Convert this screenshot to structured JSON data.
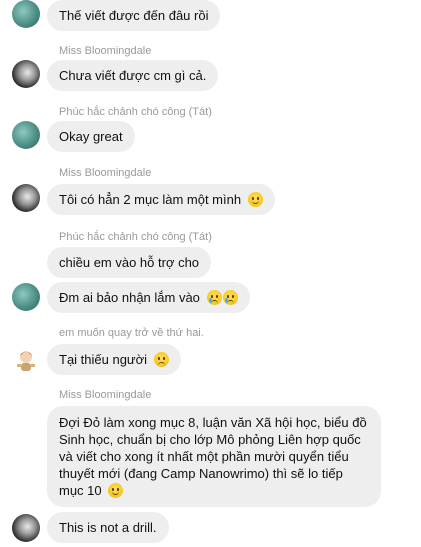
{
  "messages": [
    {
      "sender": "",
      "text": "Thế viết được đến đâu rồi",
      "emoji": []
    },
    {
      "sender": "Miss Bloomingdale",
      "text": "Chưa viết được cm gì cả.",
      "emoji": []
    },
    {
      "sender": "Phúc hắc chảnh chó công (Tát)",
      "text": "Okay great",
      "emoji": []
    },
    {
      "sender": "Miss Bloomingdale",
      "text": "Tôi có hẳn 2 mục làm một mình",
      "emoji": [
        "smile"
      ]
    },
    {
      "sender": "Phúc hắc chảnh chó công (Tát)",
      "text": "chiều em vào hỗ trợ cho",
      "emoji": []
    },
    {
      "sender": "",
      "text": "Đm ai bảo nhận lắm vào",
      "emoji": [
        "cry",
        "cry"
      ]
    },
    {
      "sender": "em muốn quay trở về thứ hai.",
      "text": "Tại thiếu người",
      "emoji": [
        "sad"
      ]
    },
    {
      "sender": "Miss Bloomingdale",
      "text": "Đợi Đỏ làm xong mục 8, luận văn Xã hội học, biểu đồ Sinh học, chuẩn bị cho lớp Mô phỏng Liên hợp quốc và viết cho xong ít nhất một phần mười quyển tiểu thuyết mới (đang Camp Nanowrimo) thì sẽ lo tiếp mục 10",
      "emoji": [
        "smile"
      ]
    },
    {
      "sender": "",
      "text": "This is not a drill.",
      "emoji": []
    }
  ],
  "colors": {
    "bubble": "#eeeeee",
    "sender": "#9a9a9a",
    "text": "#111111"
  }
}
